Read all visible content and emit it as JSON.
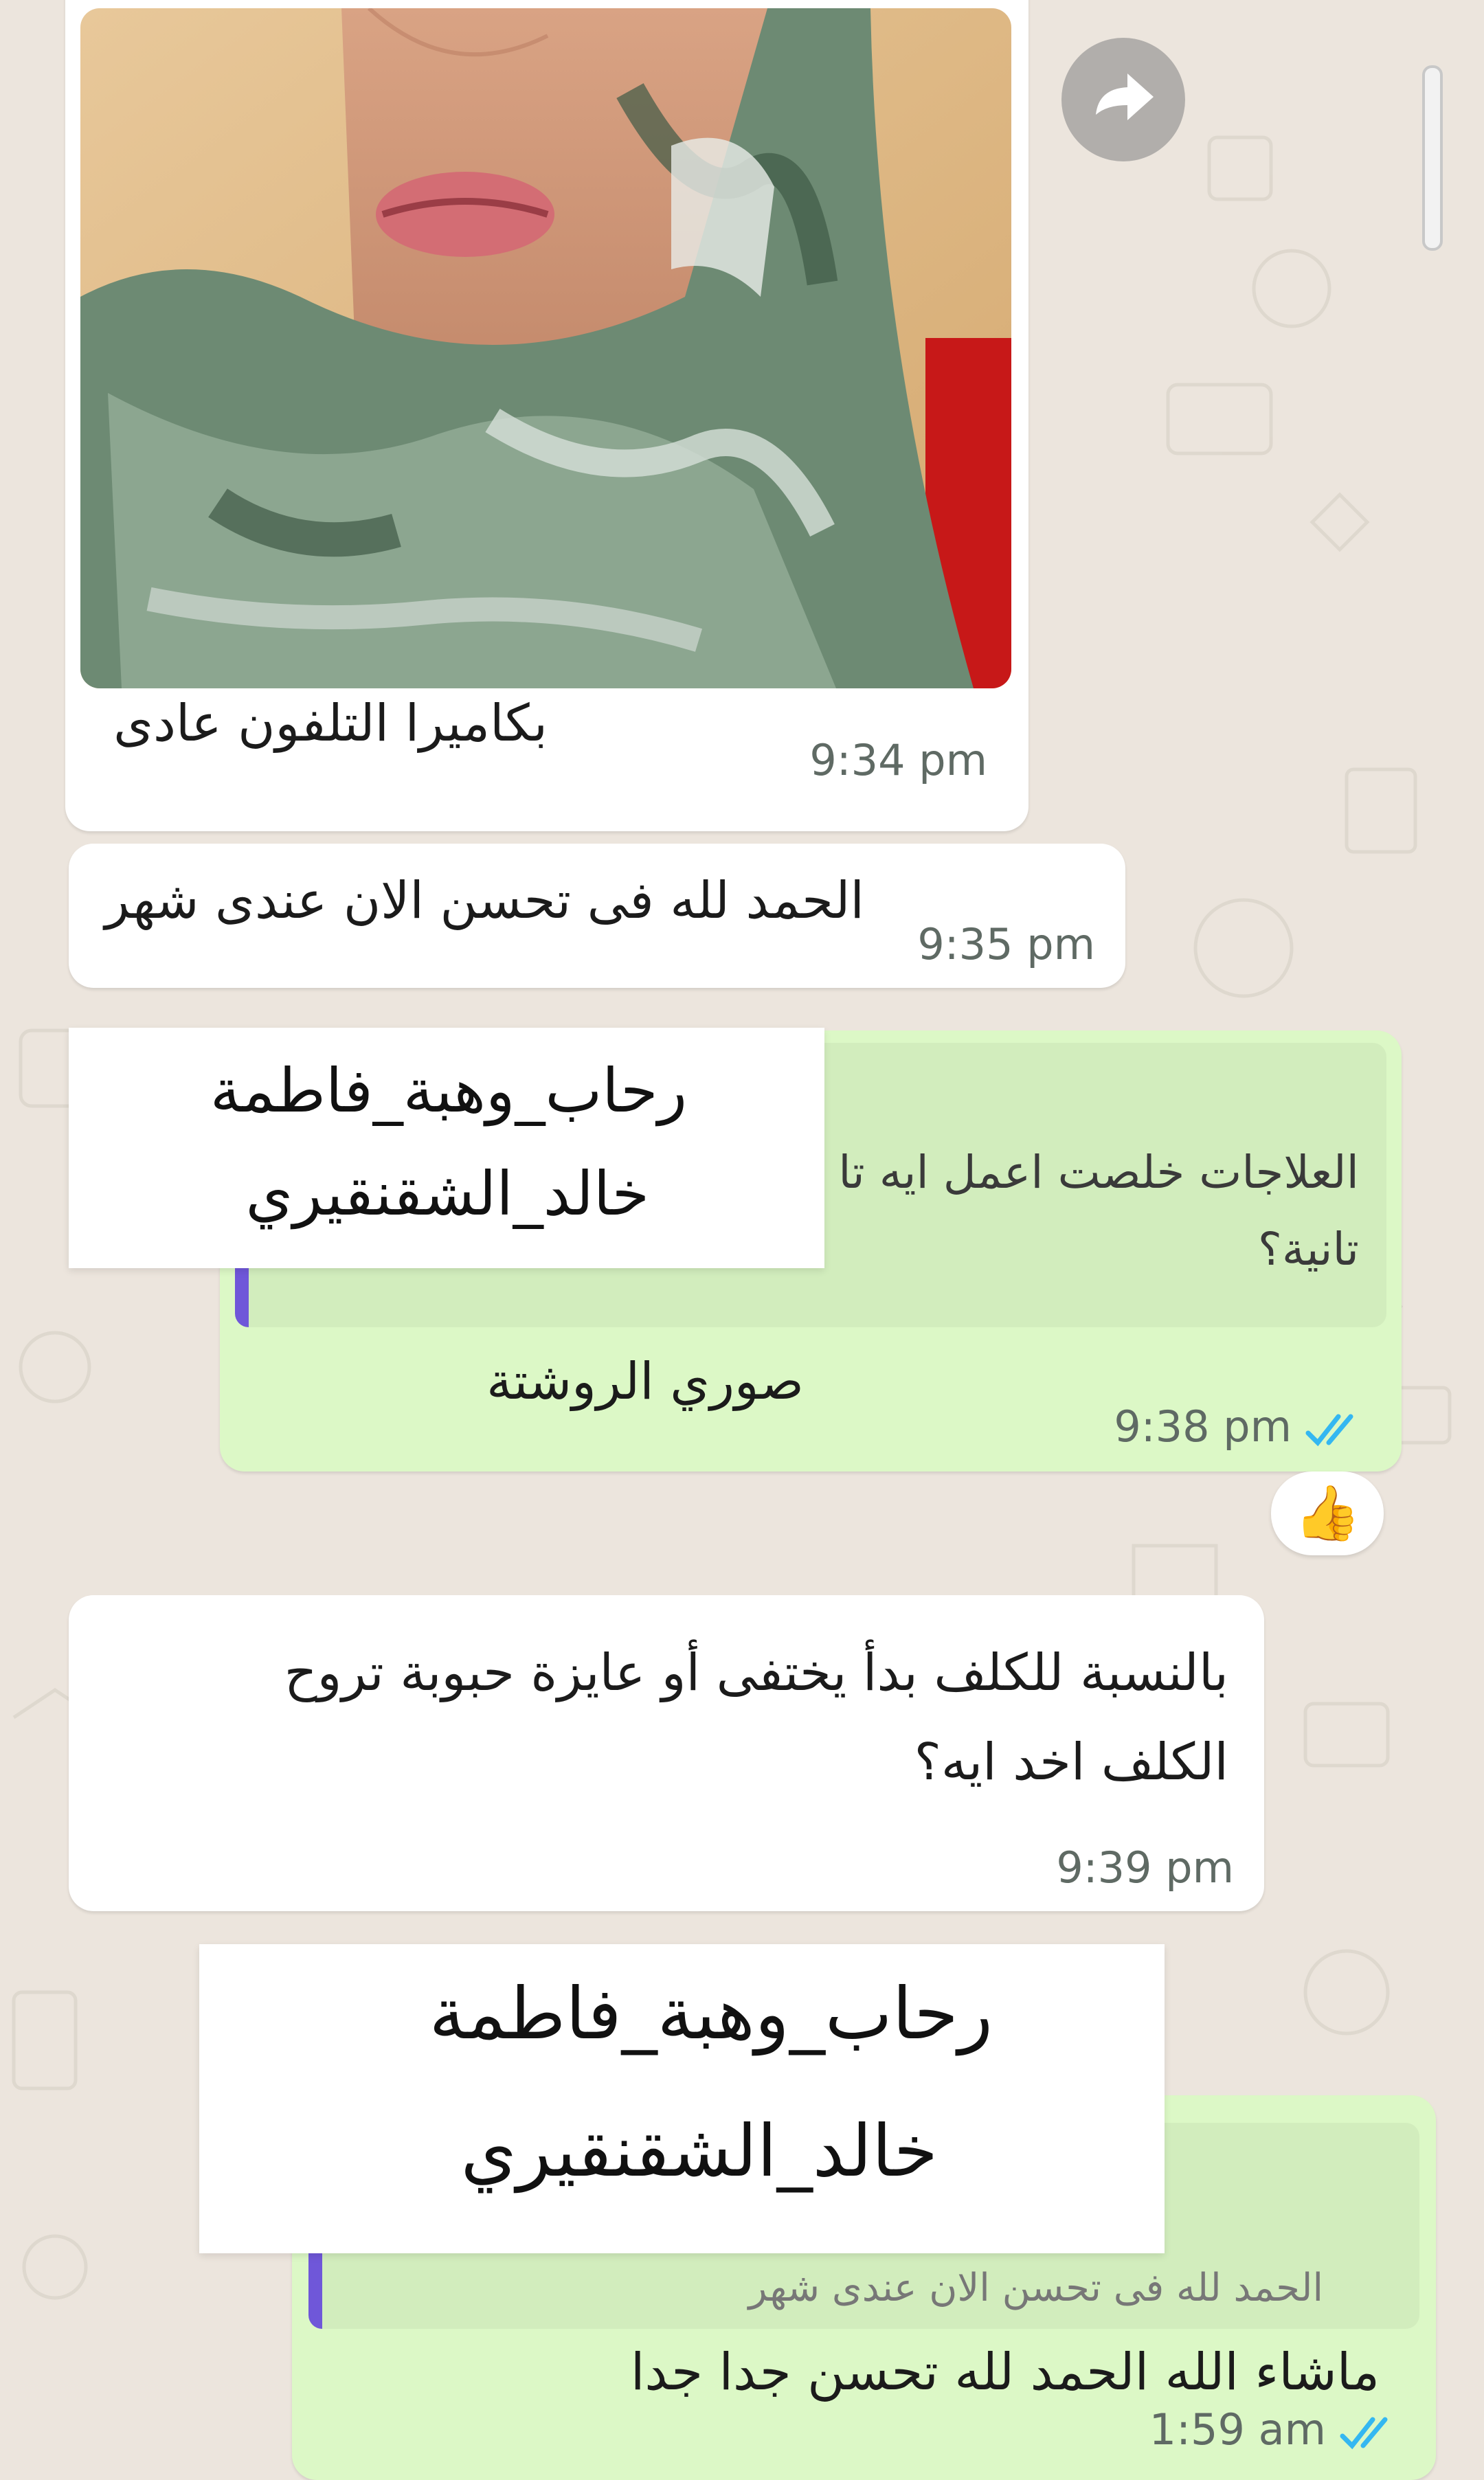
{
  "messages": [
    {
      "direction": "incoming",
      "caption": "بكاميرا التلفون عادى",
      "time": "9:34 pm",
      "photo": "selfie-photo"
    },
    {
      "direction": "incoming",
      "text": "الحمد لله فى تحسن الان عندى شهر",
      "time": "9:35 pm"
    },
    {
      "direction": "outgoing",
      "quoted_line1": "العلاجات خلصت اعمل ايه تا",
      "quoted_line2": "تانية؟",
      "text": "صوري الروشتة",
      "time": "9:38 pm",
      "status": "read",
      "reaction": "👍"
    },
    {
      "direction": "incoming",
      "line1": "بالنسبة للكلف بدأ يختفى  أو عايزة حبوبة تروح",
      "line2": "الكلف اخد ايه؟",
      "time": "9:39 pm"
    },
    {
      "direction": "outgoing",
      "quoted_text": "الحمد لله فى تحسن الان عندى شهر",
      "text": "ماشاء الله الحمد لله تحسن جدا جدا",
      "time": "1:59 am",
      "status": "read"
    }
  ],
  "watermark_labels": [
    {
      "line1": "رحاب_وهبة_فاطمة",
      "line2": "خالد_الشقنقيري"
    },
    {
      "line1": "رحاب_وهبة_فاطمة",
      "line2": "خالد_الشقنقيري"
    }
  ],
  "icons": {
    "forward": "forward-icon",
    "read_receipt": "double-check-icon",
    "reaction": "thumbs-up-emoji"
  },
  "colors": {
    "chat_background": "#ece5dd",
    "incoming_bubble": "#ffffff",
    "outgoing_bubble": "#dcf8c6",
    "quote_bar": "#6f57d9",
    "read_ticks": "#34b7f1",
    "timestamp": "#5f6a64"
  }
}
